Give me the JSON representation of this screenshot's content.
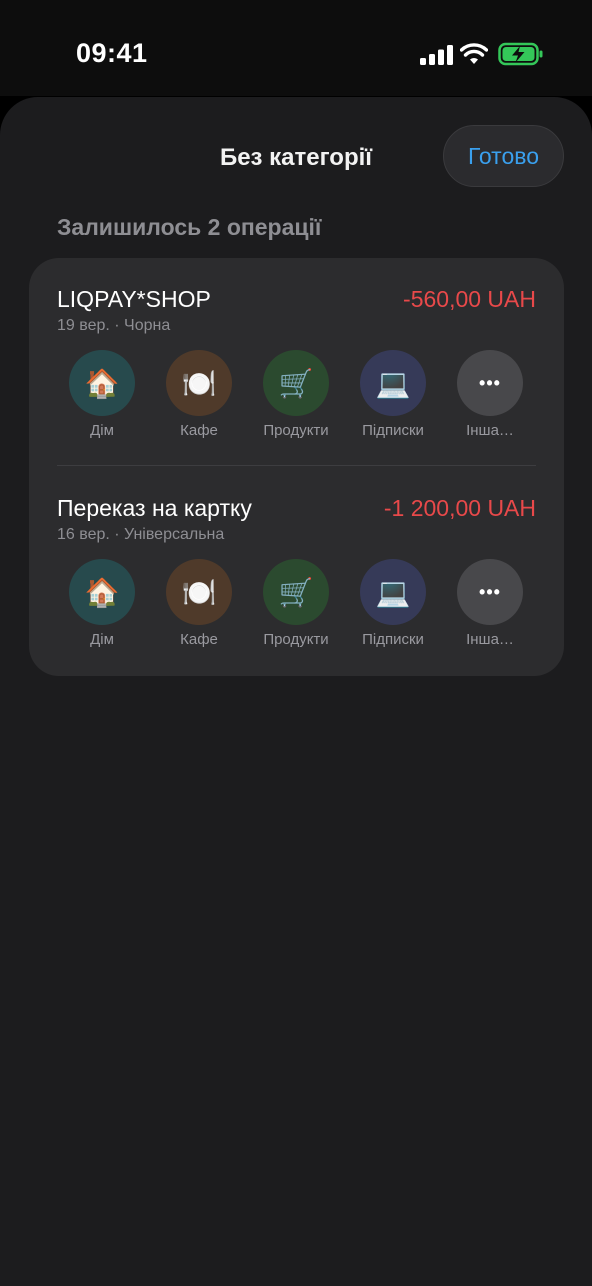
{
  "status_bar": {
    "time": "09:41"
  },
  "sheet": {
    "title": "Без категорії",
    "done_label": "Готово",
    "remaining_label": "Залишилось 2 операції"
  },
  "transactions": [
    {
      "name": "LIQPAY*SHOP",
      "amount": "-560,00 UAH",
      "meta": "19 вер. · Чорна"
    },
    {
      "name": "Переказ на картку",
      "amount": "-1 200,00 UAH",
      "meta": "16 вер. · Універсальна"
    }
  ],
  "categories": [
    {
      "label": "Дім",
      "icon": "🏠",
      "icon_name": "house-icon",
      "color": "#274a4d"
    },
    {
      "label": "Кафе",
      "icon": "🍽️",
      "icon_name": "plate-icon",
      "color": "#4f3a2a"
    },
    {
      "label": "Продукти",
      "icon": "🛒",
      "icon_name": "cart-icon",
      "color": "#2b4a2f"
    },
    {
      "label": "Підписки",
      "icon": "💻",
      "icon_name": "laptop-icon",
      "color": "#363a58"
    },
    {
      "label": "Інша…",
      "icon": "•••",
      "icon_name": "more-icon",
      "color": "#48484b"
    }
  ],
  "colors": {
    "accent": "#3aa0ee",
    "negative": "#e8494a",
    "battery": "#34c759"
  }
}
